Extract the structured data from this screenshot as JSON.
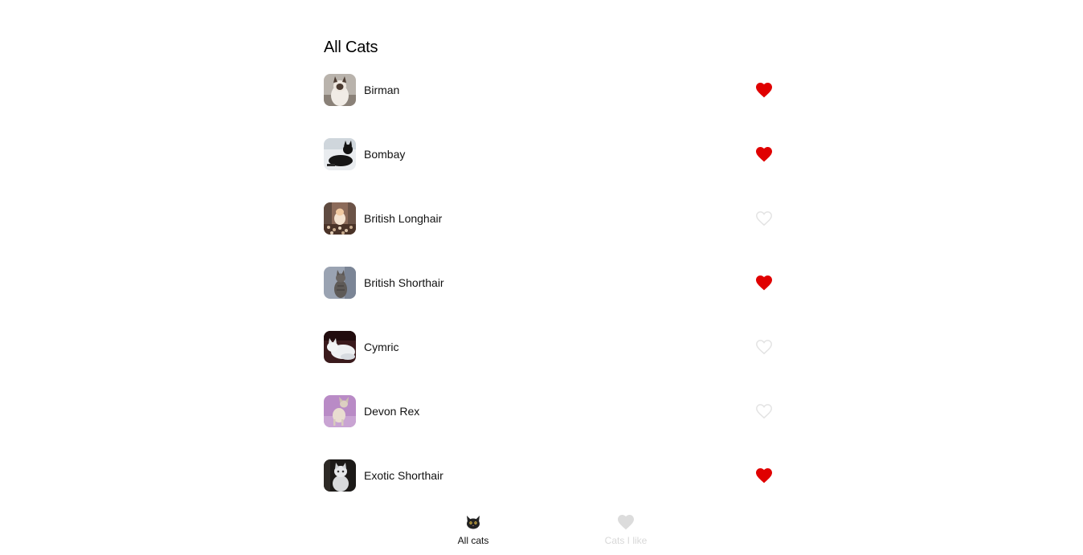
{
  "page_title": "All Cats",
  "colors": {
    "liked": "#e00000",
    "unliked_stroke": "#e3e3e3",
    "inactive_tab": "#d8d8d8"
  },
  "cats": [
    {
      "name": "Birman",
      "liked": true
    },
    {
      "name": "Bombay",
      "liked": true
    },
    {
      "name": "British Longhair",
      "liked": false
    },
    {
      "name": "British Shorthair",
      "liked": true
    },
    {
      "name": "Cymric",
      "liked": false
    },
    {
      "name": "Devon Rex",
      "liked": false
    },
    {
      "name": "Exotic Shorthair",
      "liked": true
    }
  ],
  "tabs": {
    "all_cats": {
      "label": "All cats",
      "icon": "cat-face-icon"
    },
    "cats_i_like": {
      "label": "Cats I like",
      "icon": "heart-icon"
    }
  }
}
